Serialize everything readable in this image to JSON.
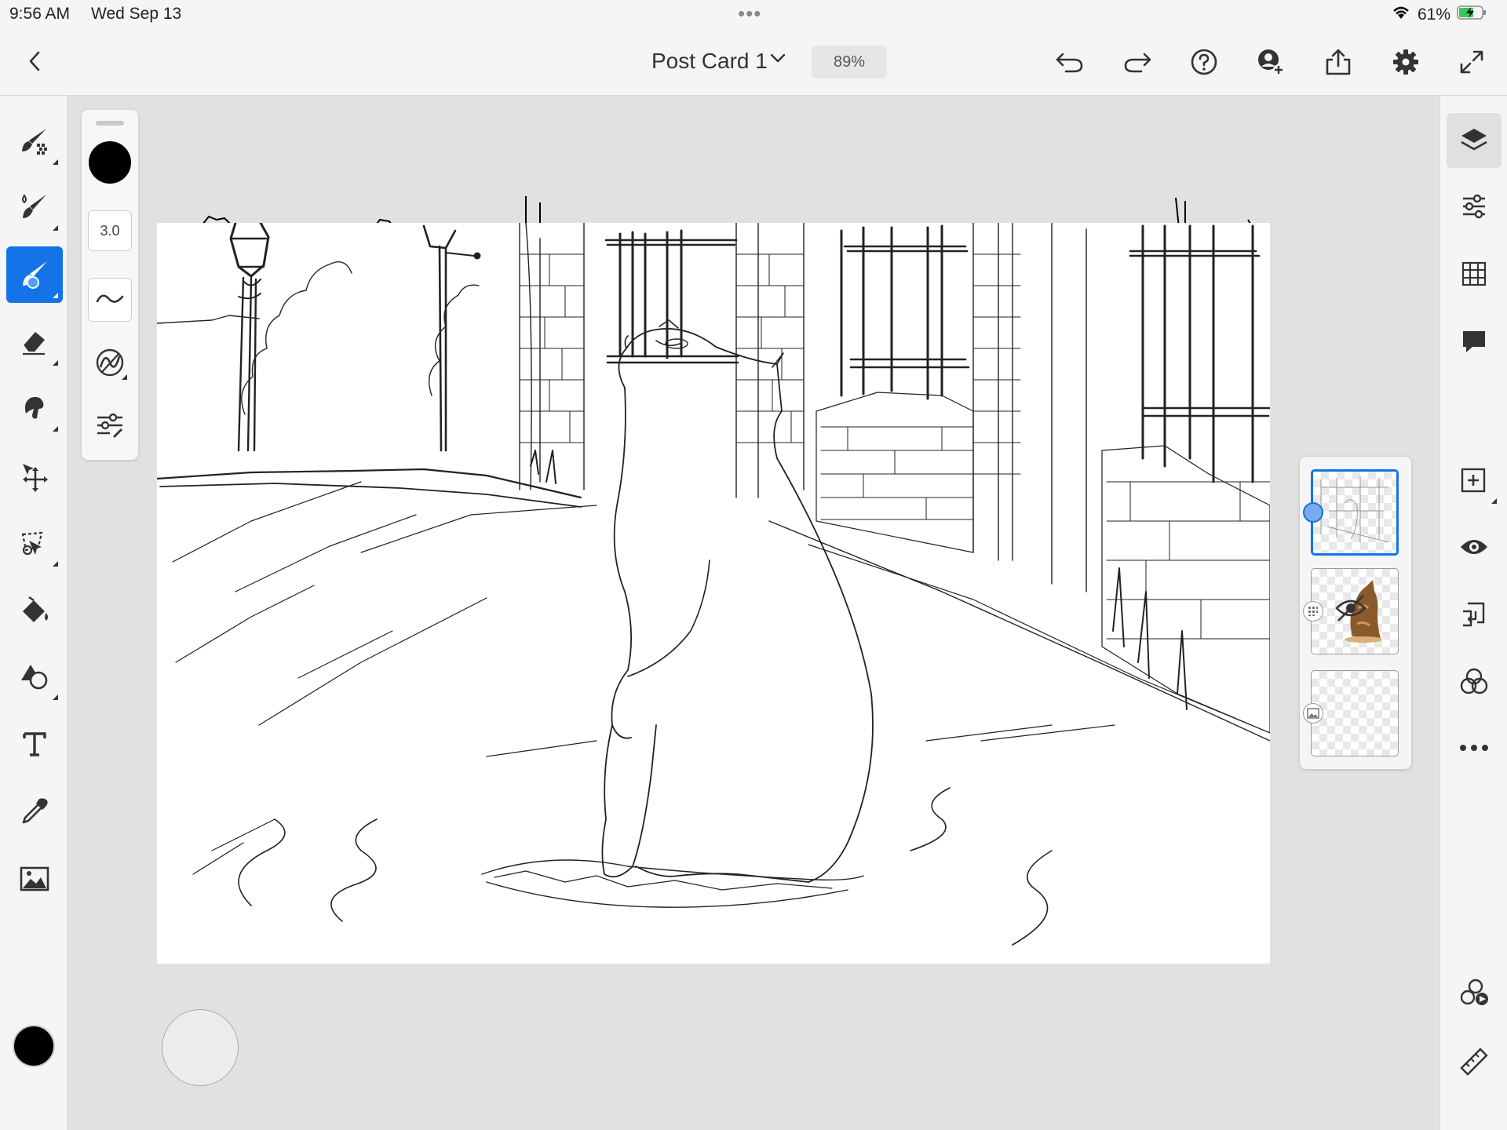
{
  "status_bar": {
    "time": "9:56 AM",
    "date": "Wed Sep 13",
    "dots": "•••",
    "battery": "61%"
  },
  "top_bar": {
    "document_title": "Post Card 1",
    "zoom": "89%",
    "icons": [
      "back-chevron-icon",
      "title-dropdown-chevron-icon",
      "undo-icon",
      "redo-icon",
      "help-icon",
      "invite-user-icon",
      "share-icon",
      "settings-gear-icon",
      "fullscreen-icon"
    ]
  },
  "left_toolbar": {
    "tools": [
      "pixel-brush-icon",
      "live-brush-icon",
      "vector-brush-icon",
      "eraser-icon",
      "smudge-icon",
      "transform-icon",
      "selection-lasso-icon",
      "fill-bucket-icon",
      "shapes-icon",
      "text-tool-icon",
      "eyedropper-icon",
      "image-icon"
    ],
    "active_tool": "vector-brush-icon",
    "current_color": "#000000"
  },
  "brush_panel": {
    "color": "#000000",
    "size": "3.0",
    "icons": [
      "brush-color-icon",
      "smoothing-icon",
      "pressure-icon",
      "brush-settings-icon"
    ]
  },
  "right_toolbar": {
    "icons": [
      "layers-icon",
      "layer-properties-icon",
      "grid-icon",
      "comments-icon",
      "add-layer-icon",
      "visibility-eye-icon",
      "import-icon",
      "blend-mode-icon",
      "more-options-icon",
      "livestream-icon",
      "ruler-icon"
    ],
    "active": "layers-icon"
  },
  "layers": [
    {
      "name": "sketch-layer",
      "selected": true,
      "badge": "active-dot-icon"
    },
    {
      "name": "cat-photo-layer",
      "selected": false,
      "badge": "pixel-layer-icon",
      "hidden": true
    },
    {
      "name": "image-layer",
      "selected": false,
      "badge": "image-layer-icon"
    }
  ],
  "colors": {
    "accent": "#1473e6",
    "toolbar_bg": "#f5f5f5",
    "workspace_bg": "#e1e1e1"
  }
}
